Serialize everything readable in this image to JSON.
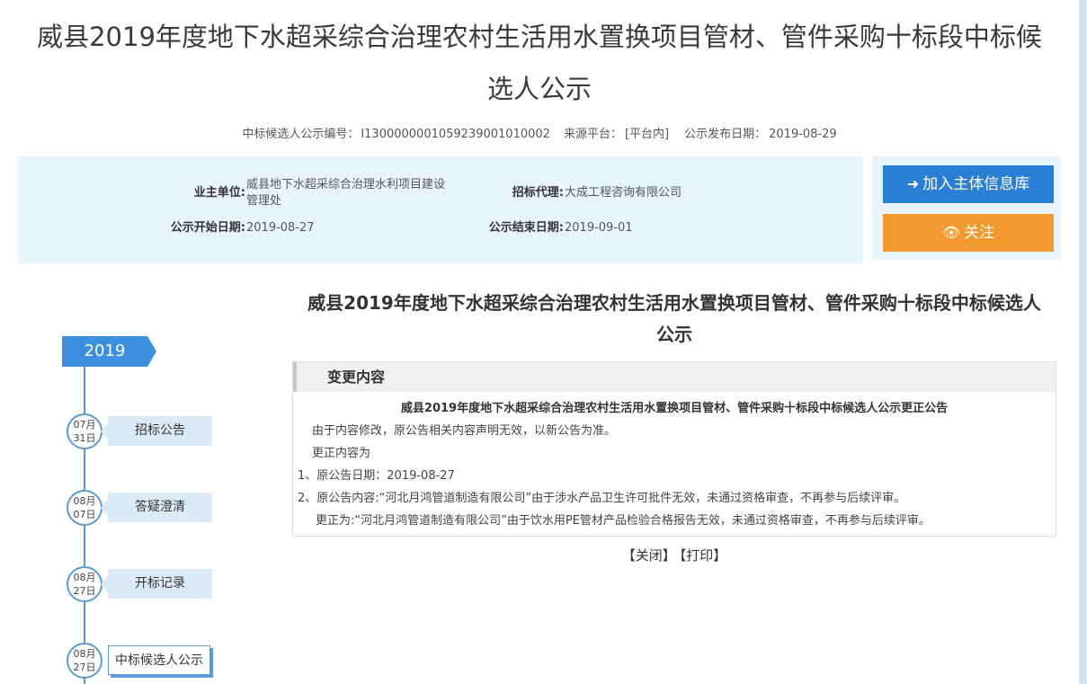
{
  "page": {
    "title_line1": "威县2019年度地下水超采综合治理农村生活用水置换项目管材、管件采购十标段中标候",
    "title_line2": "选人公示"
  },
  "meta": {
    "notice_no_label": "中标候选人公示编号：",
    "notice_no": "I1300000001059239001010002",
    "source_label": "来源平台：",
    "source": "[平台内]",
    "publish_label": "公示发布日期：",
    "publish_date": "2019-08-29"
  },
  "info": {
    "owner_label": "业主单位:",
    "owner_line1": "威县地下水超采综合治理水利项目建设",
    "owner_line2": "管理处",
    "agent_label": "招标代理:",
    "agent": "大成工程咨询有限公司",
    "start_label": "公示开始日期:",
    "start_date": "2019-08-27",
    "end_label": "公示结束日期:",
    "end_date": "2019-09-01"
  },
  "actions": {
    "add_label": "加入主体信息库",
    "follow_label": "关注"
  },
  "timeline": {
    "year": "2019",
    "items": [
      {
        "month": "07月",
        "day": "31日",
        "label": "招标公告"
      },
      {
        "month": "08月",
        "day": "07日",
        "label": "答疑澄清"
      },
      {
        "month": "08月",
        "day": "27日",
        "label": "开标记录"
      },
      {
        "month": "08月",
        "day": "27日",
        "label": "中标候选人公示"
      }
    ]
  },
  "content": {
    "title_line1": "威县2019年度地下水超采综合治理农村生活用水置换项目管材、管件采购十标段中标候选人",
    "title_line2": "公示",
    "change_header": "变更内容",
    "change_subtitle": "威县2019年度地下水超采综合治理农村生活用水置换项目管材、管件采购十标段中标候选人公示更正公告",
    "lines": [
      "由于内容修改，原公告相关内容声明无效，以新公告为准。",
      "更正内容为",
      "1、原公告日期：2019-08-27",
      "2、原公告内容:“河北月鸿管道制造有限公司”由于涉水产品卫生许可批件无效，未通过资格审查，不再参与后续评审。",
      "更正为:“河北月鸿管道制造有限公司”由于饮水用PE管材产品检验合格报告无效，未通过资格审查，不再参与后续评审。"
    ]
  },
  "footer": {
    "close_label": "【关闭】",
    "print_label": "【打印】"
  }
}
